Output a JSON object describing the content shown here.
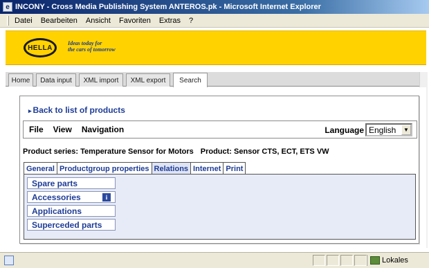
{
  "window": {
    "title": "INCONY - Cross Media Publishing System ANTEROS.pk - Microsoft Internet Explorer"
  },
  "menubar": {
    "items": [
      "Datei",
      "Bearbeiten",
      "Ansicht",
      "Favoriten",
      "Extras",
      "?"
    ]
  },
  "brand": {
    "logo": "HELLA",
    "tagline_line1": "Ideas today for",
    "tagline_line2": "the cars of tomorrow",
    "accent": "#ffd200"
  },
  "app_tabs": [
    {
      "label": "Home"
    },
    {
      "label": "Data input"
    },
    {
      "label": "XML import"
    },
    {
      "label": "XML export"
    },
    {
      "label": "Search",
      "active": true
    }
  ],
  "back_link": "Back to list of products",
  "toolbar": {
    "file": "File",
    "view": "View",
    "navigation": "Navigation",
    "language_label": "Language",
    "language_value": "English"
  },
  "product": {
    "series": "Product series: Temperature Sensor for Motors",
    "product": "Product: Sensor CTS, ECT, ETS VW"
  },
  "sub_tabs": [
    {
      "label": "General"
    },
    {
      "label": "Productgroup properties"
    },
    {
      "label": "Relations",
      "active": true
    },
    {
      "label": "Internet"
    },
    {
      "label": "Print"
    }
  ],
  "relations": {
    "spare_parts": "Spare parts",
    "accessories": "Accessories",
    "info_badge": "i",
    "applications": "Applications",
    "superceded_parts": "Superceded parts"
  },
  "statusbar": {
    "zone": "Lokales"
  }
}
